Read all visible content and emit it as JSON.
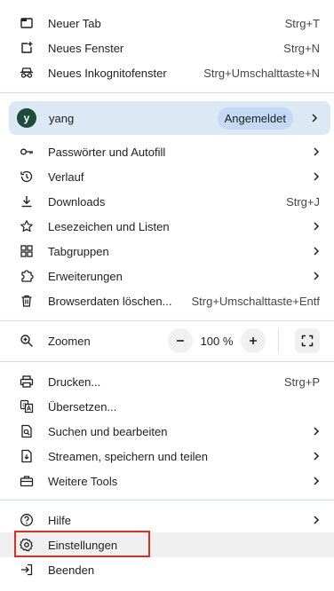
{
  "section1": {
    "new_tab": {
      "label": "Neuer Tab",
      "shortcut": "Strg+T"
    },
    "new_window": {
      "label": "Neues Fenster",
      "shortcut": "Strg+N"
    },
    "incognito": {
      "label": "Neues Inkognitofenster",
      "shortcut": "Strg+Umschalttaste+N"
    }
  },
  "profile": {
    "avatar_letter": "y",
    "name": "yang",
    "status": "Angemeldet"
  },
  "section2": {
    "passwords": {
      "label": "Passwörter und Autofill"
    },
    "history": {
      "label": "Verlauf"
    },
    "downloads": {
      "label": "Downloads",
      "shortcut": "Strg+J"
    },
    "bookmarks": {
      "label": "Lesezeichen und Listen"
    },
    "tab_groups": {
      "label": "Tabgruppen"
    },
    "extensions": {
      "label": "Erweiterungen"
    },
    "clear_data": {
      "label": "Browserdaten löschen...",
      "shortcut": "Strg+Umschalttaste+Entf"
    }
  },
  "zoom": {
    "label": "Zoomen",
    "value": "100 %"
  },
  "section4": {
    "print": {
      "label": "Drucken...",
      "shortcut": "Strg+P"
    },
    "translate": {
      "label": "Übersetzen..."
    },
    "find_edit": {
      "label": "Suchen und bearbeiten"
    },
    "cast_save_share": {
      "label": "Streamen, speichern und teilen"
    },
    "more_tools": {
      "label": "Weitere Tools"
    }
  },
  "section5": {
    "help": {
      "label": "Hilfe"
    },
    "settings": {
      "label": "Einstellungen"
    },
    "exit": {
      "label": "Beenden"
    }
  },
  "colors": {
    "profile_bg": "#dce8f3",
    "badge_bg": "#c4daf4",
    "avatar_bg": "#1e4b3b",
    "highlight_bg": "#f0f0f0",
    "annotation_box": "#d93025",
    "divider": "#c9dde6"
  },
  "icons": {
    "new_tab": "new-tab-icon",
    "new_window": "new-window-icon",
    "incognito": "incognito-icon",
    "passwords": "key-icon",
    "history": "history-icon",
    "downloads": "download-icon",
    "bookmarks": "star-icon",
    "tab_groups": "grid-icon",
    "extensions": "puzzle-icon",
    "clear_data": "trash-icon",
    "zoom": "zoom-icon",
    "print": "printer-icon",
    "translate": "translate-icon",
    "find_edit": "find-icon",
    "cast": "cast-icon",
    "more_tools": "toolbox-icon",
    "help": "help-icon",
    "settings": "gear-icon",
    "exit": "exit-icon"
  }
}
